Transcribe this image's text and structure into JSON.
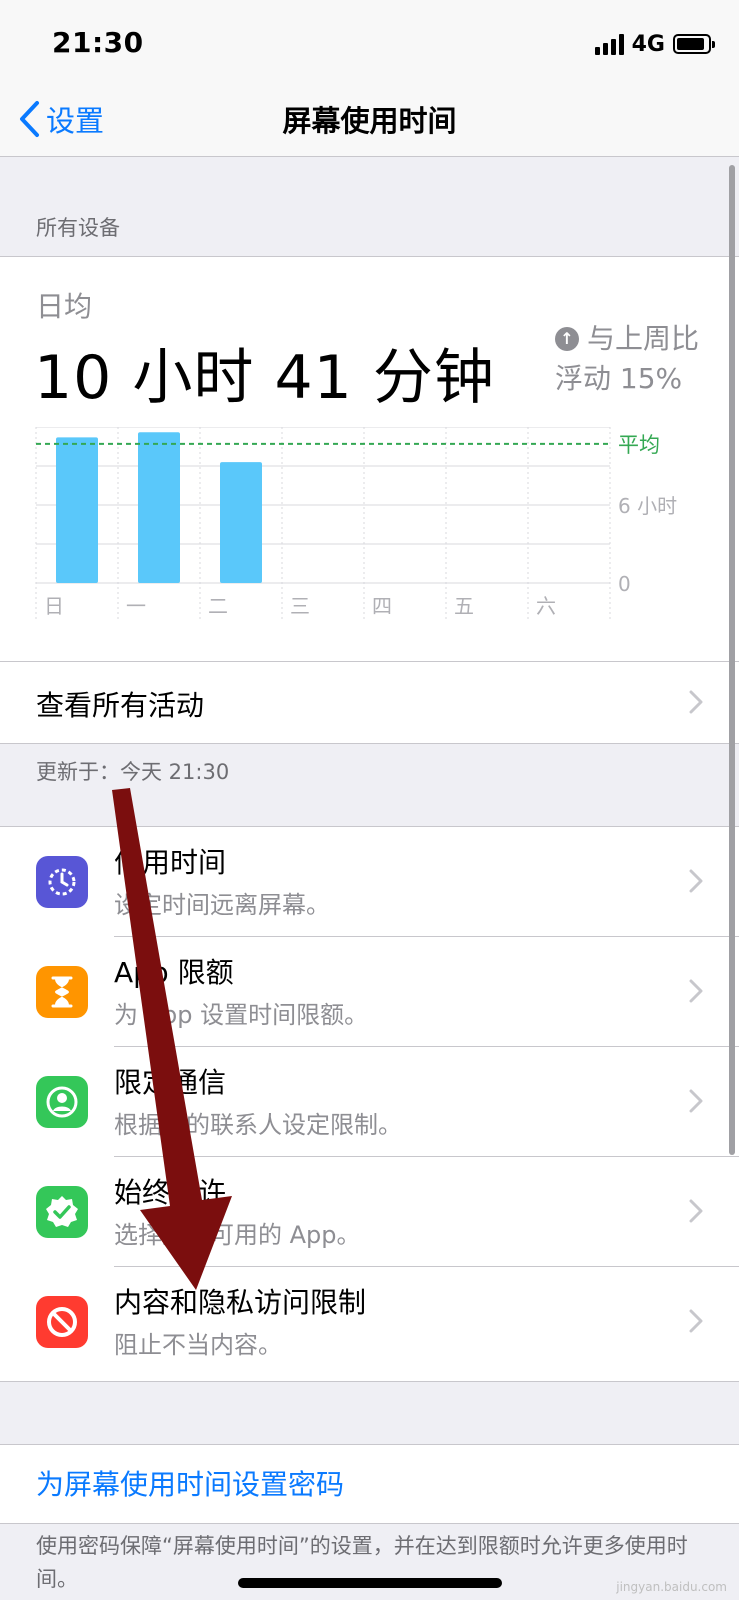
{
  "status": {
    "time": "21:30",
    "network": "4G"
  },
  "nav": {
    "back_label": "设置",
    "title": "屏幕使用时间"
  },
  "devices_header": "所有设备",
  "summary": {
    "avg_label": "日均",
    "avg_value": "10 小时 41 分钟",
    "compare_line1": "与上周比",
    "compare_line2": "浮动 15%"
  },
  "chart_data": {
    "type": "bar",
    "categories": [
      "日",
      "一",
      "二",
      "三",
      "四",
      "五",
      "六"
    ],
    "values": [
      11.2,
      11.6,
      9.3,
      0,
      0,
      0,
      0
    ],
    "average": 10.7,
    "ylim": [
      0,
      12
    ],
    "y_tick_labels": [
      "0",
      "6 小时"
    ],
    "avg_label": "平均",
    "colors": {
      "bar": "#5ac8fa",
      "avg_line": "#34a853",
      "grid": "#d9d9de"
    }
  },
  "activity_link": "查看所有活动",
  "updated_text": "更新于：今天 21:30",
  "menu": [
    {
      "title": "停用时间",
      "subtitle": "设定时间远离屏幕。",
      "color": "#5856d6",
      "icon": "downtime-icon"
    },
    {
      "title": "App 限额",
      "subtitle": "为 App 设置时间限额。",
      "color": "#ff9500",
      "icon": "hourglass-icon"
    },
    {
      "title": "限定通信",
      "subtitle": "根据您的联系人设定限制。",
      "color": "#34c759",
      "icon": "contact-icon"
    },
    {
      "title": "始终允许",
      "subtitle": "选择始终可用的 App。",
      "color": "#34c759",
      "icon": "checkmark-badge-icon"
    },
    {
      "title": "内容和隐私访问限制",
      "subtitle": "阻止不当内容。",
      "color": "#ff3b30",
      "icon": "restriction-icon"
    }
  ],
  "passcode_link": "为屏幕使用时间设置密码",
  "footer_text": "使用密码保障“屏幕使用时间”的设置，并在达到限额时允许更多使用时间。",
  "watermark": "jingyan.baidu.com"
}
